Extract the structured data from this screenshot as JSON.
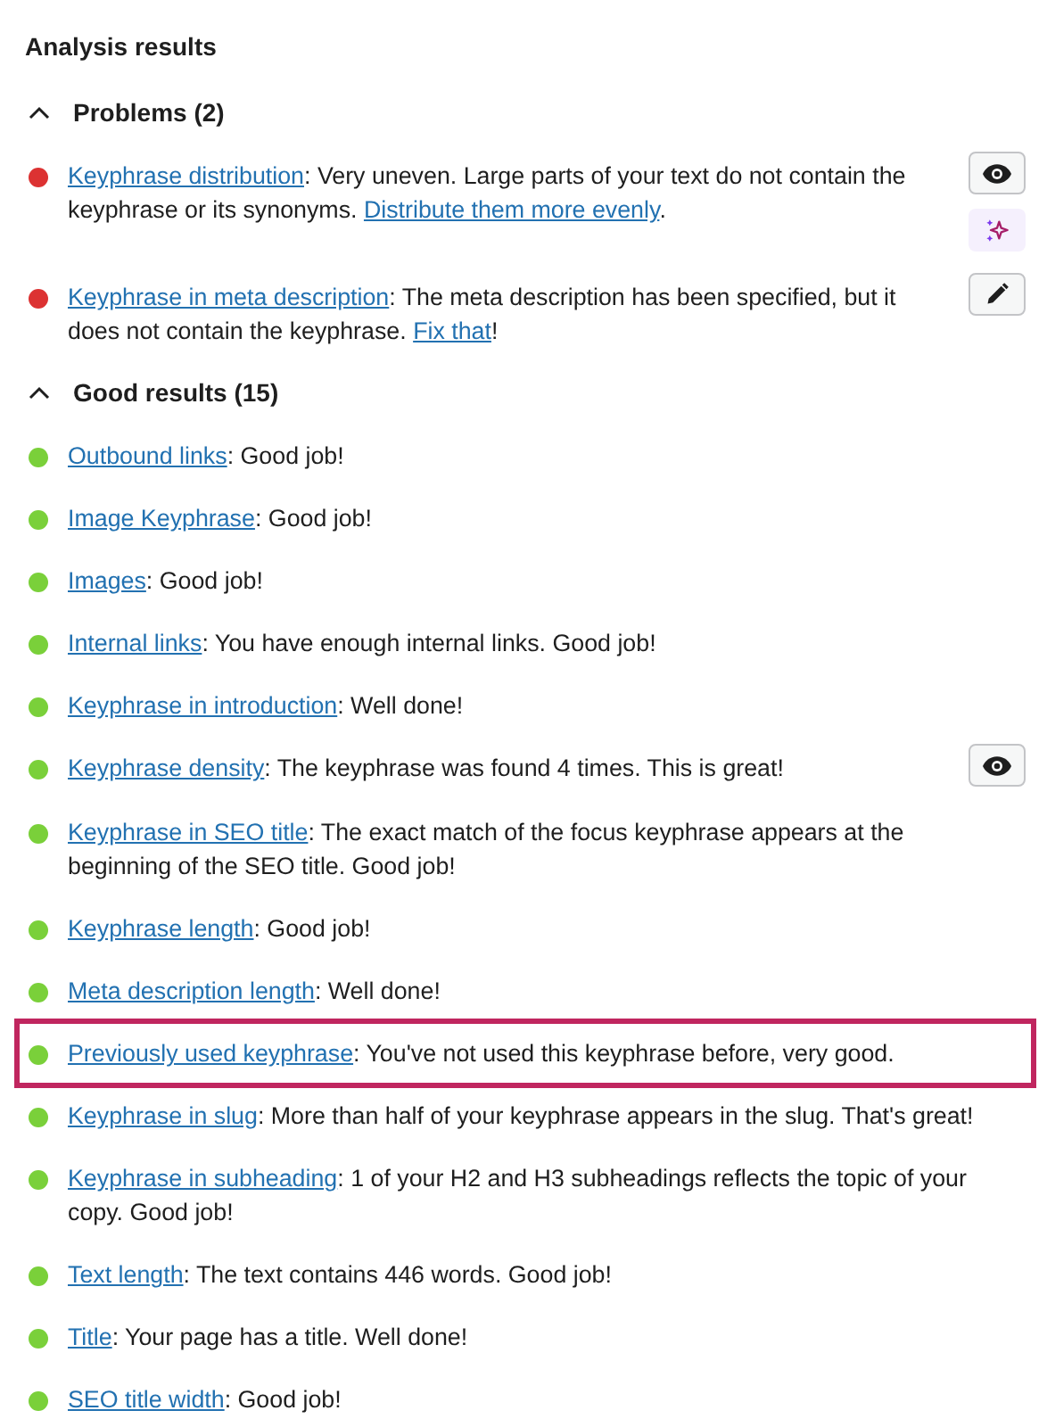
{
  "title": "Analysis results",
  "sections": [
    {
      "heading": "Problems (2)",
      "expanded": true,
      "results": [
        {
          "color": "#dc3232",
          "highlighted": false,
          "parts": [
            {
              "kind": "link",
              "text": "Keyphrase distribution"
            },
            {
              "kind": "text",
              "text": ": Very uneven. Large parts of your text do not contain the keyphrase or its synonyms. "
            },
            {
              "kind": "link",
              "text": "Distribute them more evenly"
            },
            {
              "kind": "text",
              "text": "."
            }
          ],
          "buttons": [
            {
              "kind": "eye"
            },
            {
              "kind": "sparkle"
            }
          ]
        },
        {
          "color": "#dc3232",
          "highlighted": false,
          "parts": [
            {
              "kind": "link",
              "text": "Keyphrase in meta description"
            },
            {
              "kind": "text",
              "text": ": The meta description has been specified, but it does not contain the keyphrase. "
            },
            {
              "kind": "link",
              "text": "Fix that"
            },
            {
              "kind": "text",
              "text": "!"
            }
          ],
          "buttons": [
            {
              "kind": "pencil"
            }
          ]
        }
      ]
    },
    {
      "heading": "Good results (15)",
      "expanded": true,
      "results": [
        {
          "color": "#7ad03a",
          "highlighted": false,
          "parts": [
            {
              "kind": "link",
              "text": "Outbound links"
            },
            {
              "kind": "text",
              "text": ": Good job!"
            }
          ]
        },
        {
          "color": "#7ad03a",
          "highlighted": false,
          "parts": [
            {
              "kind": "link",
              "text": "Image Keyphrase"
            },
            {
              "kind": "text",
              "text": ": Good job!"
            }
          ]
        },
        {
          "color": "#7ad03a",
          "highlighted": false,
          "parts": [
            {
              "kind": "link",
              "text": "Images"
            },
            {
              "kind": "text",
              "text": ": Good job!"
            }
          ]
        },
        {
          "color": "#7ad03a",
          "highlighted": false,
          "parts": [
            {
              "kind": "link",
              "text": "Internal links"
            },
            {
              "kind": "text",
              "text": ": You have enough internal links. Good job!"
            }
          ]
        },
        {
          "color": "#7ad03a",
          "highlighted": false,
          "parts": [
            {
              "kind": "link",
              "text": "Keyphrase in introduction"
            },
            {
              "kind": "text",
              "text": ": Well done!"
            }
          ]
        },
        {
          "color": "#7ad03a",
          "highlighted": false,
          "parts": [
            {
              "kind": "link",
              "text": "Keyphrase density"
            },
            {
              "kind": "text",
              "text": ": The keyphrase was found 4 times. This is great!"
            }
          ],
          "buttons": [
            {
              "kind": "eye"
            }
          ]
        },
        {
          "color": "#7ad03a",
          "highlighted": false,
          "parts": [
            {
              "kind": "link",
              "text": "Keyphrase in SEO title"
            },
            {
              "kind": "text",
              "text": ": The exact match of the focus keyphrase appears at the beginning of the SEO title. Good job!"
            }
          ]
        },
        {
          "color": "#7ad03a",
          "highlighted": false,
          "parts": [
            {
              "kind": "link",
              "text": "Keyphrase length"
            },
            {
              "kind": "text",
              "text": ": Good job!"
            }
          ]
        },
        {
          "color": "#7ad03a",
          "highlighted": false,
          "parts": [
            {
              "kind": "link",
              "text": "Meta description length"
            },
            {
              "kind": "text",
              "text": ": Well done!"
            }
          ]
        },
        {
          "color": "#7ad03a",
          "highlighted": true,
          "parts": [
            {
              "kind": "link",
              "text": "Previously used keyphrase"
            },
            {
              "kind": "text",
              "text": ": You've not used this keyphrase before, very good."
            }
          ]
        },
        {
          "color": "#7ad03a",
          "highlighted": false,
          "parts": [
            {
              "kind": "link",
              "text": "Keyphrase in slug"
            },
            {
              "kind": "text",
              "text": ": More than half of your keyphrase appears in the slug. That's great!"
            }
          ]
        },
        {
          "color": "#7ad03a",
          "highlighted": false,
          "parts": [
            {
              "kind": "link",
              "text": "Keyphrase in subheading"
            },
            {
              "kind": "text",
              "text": ": 1 of your H2 and H3 subheadings reflects the topic of your copy. Good job!"
            }
          ]
        },
        {
          "color": "#7ad03a",
          "highlighted": false,
          "parts": [
            {
              "kind": "link",
              "text": "Text length"
            },
            {
              "kind": "text",
              "text": ": The text contains 446 words. Good job!"
            }
          ]
        },
        {
          "color": "#7ad03a",
          "highlighted": false,
          "parts": [
            {
              "kind": "link",
              "text": "Title"
            },
            {
              "kind": "text",
              "text": ": Your page has a title. Well done!"
            }
          ]
        },
        {
          "color": "#7ad03a",
          "highlighted": false,
          "parts": [
            {
              "kind": "link",
              "text": "SEO title width"
            },
            {
              "kind": "text",
              "text": ": Good job!"
            }
          ]
        }
      ]
    }
  ]
}
